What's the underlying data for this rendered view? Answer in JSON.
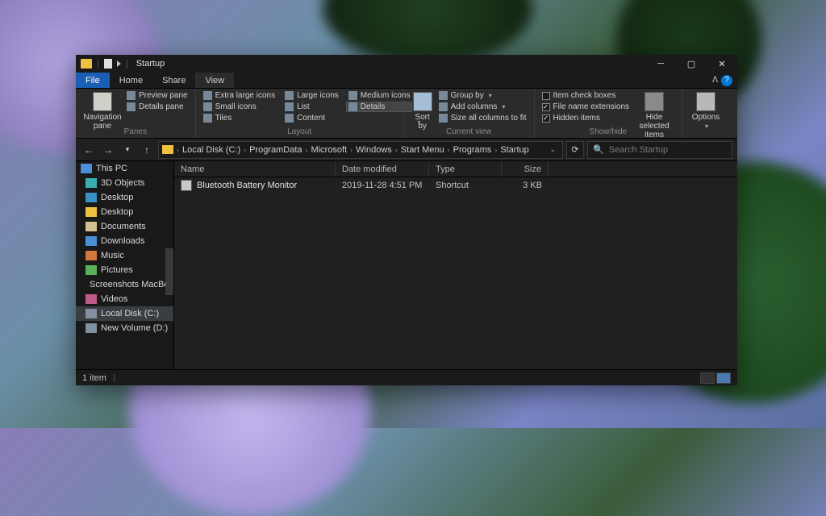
{
  "window": {
    "title": "Startup"
  },
  "tabs": {
    "file": "File",
    "home": "Home",
    "share": "Share",
    "view": "View"
  },
  "ribbon": {
    "panes": {
      "nav": "Navigation\npane",
      "preview": "Preview pane",
      "details": "Details pane",
      "label": "Panes"
    },
    "layout": {
      "extra_large": "Extra large icons",
      "large": "Large icons",
      "medium": "Medium icons",
      "small": "Small icons",
      "list": "List",
      "content": "Content",
      "tiles": "Tiles",
      "details": "Details",
      "label": "Layout"
    },
    "current": {
      "sort": "Sort\nby",
      "group": "Group by",
      "add_cols": "Add columns",
      "size_all": "Size all columns to fit",
      "label": "Current view"
    },
    "showhide": {
      "item_check": "Item check boxes",
      "ext": "File name extensions",
      "hidden": "Hidden items",
      "hide_sel": "Hide selected\nitems",
      "label": "Show/hide"
    },
    "options": "Options"
  },
  "breadcrumb": [
    "Local Disk (C:)",
    "ProgramData",
    "Microsoft",
    "Windows",
    "Start Menu",
    "Programs",
    "Startup"
  ],
  "search": {
    "placeholder": "Search Startup"
  },
  "sidebar": [
    {
      "icon": "ico-pc",
      "label": "This PC"
    },
    {
      "icon": "ico-3d",
      "label": "3D Objects"
    },
    {
      "icon": "ico-desk",
      "label": "Desktop"
    },
    {
      "icon": "ico-fold",
      "label": "Desktop"
    },
    {
      "icon": "ico-doc",
      "label": "Documents"
    },
    {
      "icon": "ico-down",
      "label": "Downloads"
    },
    {
      "icon": "ico-mus",
      "label": "Music"
    },
    {
      "icon": "ico-pic",
      "label": "Pictures"
    },
    {
      "icon": "ico-fold",
      "label": "Screenshots MacBoo"
    },
    {
      "icon": "ico-vid",
      "label": "Videos"
    },
    {
      "icon": "ico-disk",
      "label": "Local Disk (C:)",
      "selected": true
    },
    {
      "icon": "ico-disk",
      "label": "New Volume (D:)"
    }
  ],
  "columns": {
    "name": "Name",
    "date": "Date modified",
    "type": "Type",
    "size": "Size"
  },
  "files": [
    {
      "name": "Bluetooth Battery Monitor",
      "date": "2019-11-28 4:51 PM",
      "type": "Shortcut",
      "size": "3 KB"
    }
  ],
  "status": {
    "count": "1 item"
  }
}
